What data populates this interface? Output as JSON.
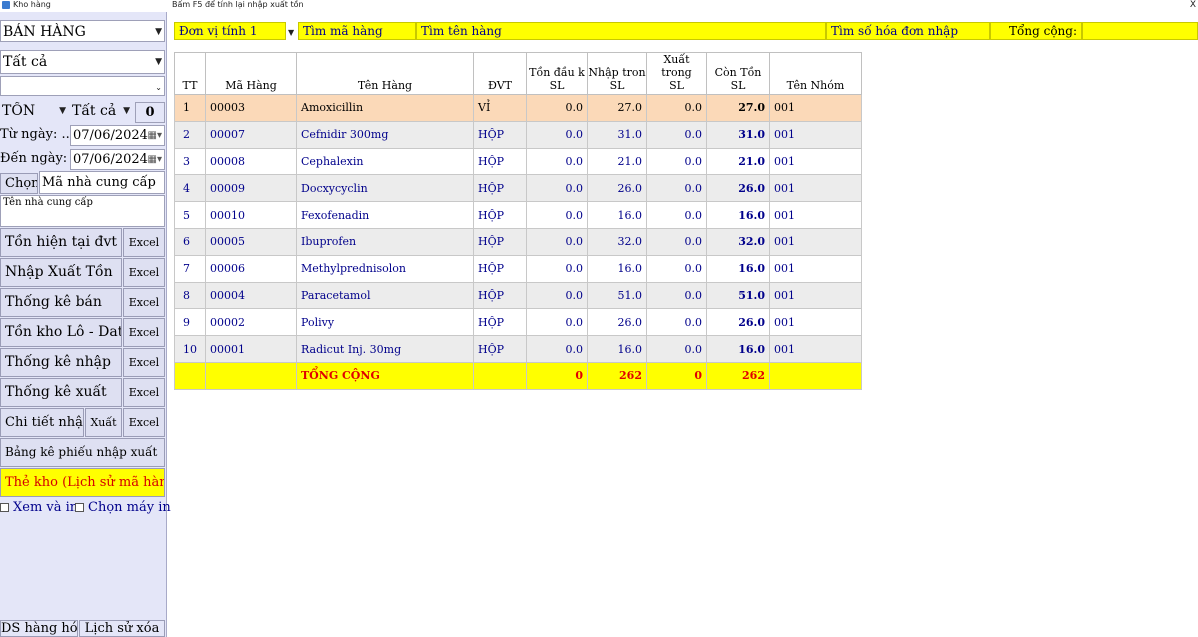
{
  "window": {
    "title": "Kho hàng",
    "hint": "Bấm F5 để tính lại nhập xuất tồn",
    "close": "X"
  },
  "left": {
    "mode_select": "BÁN HÀNG",
    "filter_select": "Tất cả",
    "empty_select": "",
    "stock_select": "TỒN",
    "stock_filter": "Tất cả",
    "stock_count": "0",
    "from_label": "Từ ngày: ...",
    "from_date": "07/06/2024",
    "to_label": "Đến ngày:",
    "to_date": "07/06/2024",
    "choose_label": "Chọn",
    "supplier_code_placeholder": "Mã nhà cung cấp",
    "supplier_name_placeholder": "Tên nhà cung cấp",
    "buttons": {
      "current_stock": "Tồn hiện tại đvt",
      "import_export_stock": "Nhập Xuất Tồn",
      "sales_stats": "Thống kê bán",
      "stock_lot_date": "Tồn kho Lô - Date",
      "import_stats": "Thống kê nhập",
      "export_stats": "Thống kê xuất",
      "import_detail": "Chi tiết nhập",
      "export": "Xuất",
      "excel": "Excel",
      "voucher_list": "Bảng kê phiếu nhập xuất",
      "stock_card": "Thẻ kho (Lịch sử mã hàng)"
    },
    "check_preview": "Xem và in",
    "check_printer": "Chọn máy in",
    "bottom_goods_list": "DS hàng hóa",
    "bottom_delete_history": "Lịch sử xóa"
  },
  "topbar": {
    "unit": "Đơn vị tính 1",
    "search_code": "Tìm mã hàng",
    "search_name": "Tìm tên hàng",
    "search_invoice": "Tìm số hóa đơn nhập",
    "total_label": "Tổng cộng:",
    "total_value": ""
  },
  "table": {
    "headers": {
      "tt": "TT",
      "code": "Mã Hàng",
      "name": "Tên Hàng",
      "unit": "ĐVT",
      "opening_top": "Tồn đầu k",
      "opening_sub": "SL",
      "import_top": "Nhập tron",
      "import_sub": "SL",
      "export_top": "Xuất trong",
      "export_sub": "SL",
      "closing_top": "Còn Tồn",
      "closing_sub": "SL",
      "group": "Tên Nhóm"
    },
    "rows": [
      {
        "tt": "1",
        "code": "00003",
        "name": "Amoxicillin",
        "unit": "VỈ",
        "opening": "0.0",
        "import": "27.0",
        "export": "0.0",
        "closing": "27.0",
        "group": "001"
      },
      {
        "tt": "2",
        "code": "00007",
        "name": "Cefnidir 300mg",
        "unit": "HỘP",
        "opening": "0.0",
        "import": "31.0",
        "export": "0.0",
        "closing": "31.0",
        "group": "001"
      },
      {
        "tt": "3",
        "code": "00008",
        "name": "Cephalexin",
        "unit": "HỘP",
        "opening": "0.0",
        "import": "21.0",
        "export": "0.0",
        "closing": "21.0",
        "group": "001"
      },
      {
        "tt": "4",
        "code": "00009",
        "name": "Docxycyclin",
        "unit": "HỘP",
        "opening": "0.0",
        "import": "26.0",
        "export": "0.0",
        "closing": "26.0",
        "group": "001"
      },
      {
        "tt": "5",
        "code": "00010",
        "name": "Fexofenadin",
        "unit": "HỘP",
        "opening": "0.0",
        "import": "16.0",
        "export": "0.0",
        "closing": "16.0",
        "group": "001"
      },
      {
        "tt": "6",
        "code": "00005",
        "name": "Ibuprofen",
        "unit": "HỘP",
        "opening": "0.0",
        "import": "32.0",
        "export": "0.0",
        "closing": "32.0",
        "group": "001"
      },
      {
        "tt": "7",
        "code": "00006",
        "name": "Methylprednisolon",
        "unit": "HỘP",
        "opening": "0.0",
        "import": "16.0",
        "export": "0.0",
        "closing": "16.0",
        "group": "001"
      },
      {
        "tt": "8",
        "code": "00004",
        "name": "Paracetamol",
        "unit": "HỘP",
        "opening": "0.0",
        "import": "51.0",
        "export": "0.0",
        "closing": "51.0",
        "group": "001"
      },
      {
        "tt": "9",
        "code": "00002",
        "name": "Polivy",
        "unit": "HỘP",
        "opening": "0.0",
        "import": "26.0",
        "export": "0.0",
        "closing": "26.0",
        "group": "001"
      },
      {
        "tt": "10",
        "code": "00001",
        "name": "Radicut Inj. 30mg",
        "unit": "HỘP",
        "opening": "0.0",
        "import": "16.0",
        "export": "0.0",
        "closing": "16.0",
        "group": "001"
      }
    ],
    "total": {
      "label": "TỔNG CỘNG",
      "opening": "0",
      "import": "262",
      "export": "0",
      "closing": "262"
    }
  },
  "colors": {
    "panel": "#e4e6f8",
    "highlight": "#ffff00",
    "selected_row": "#fbd9b8",
    "text_blue": "#00008b",
    "total_red": "#e00000"
  }
}
